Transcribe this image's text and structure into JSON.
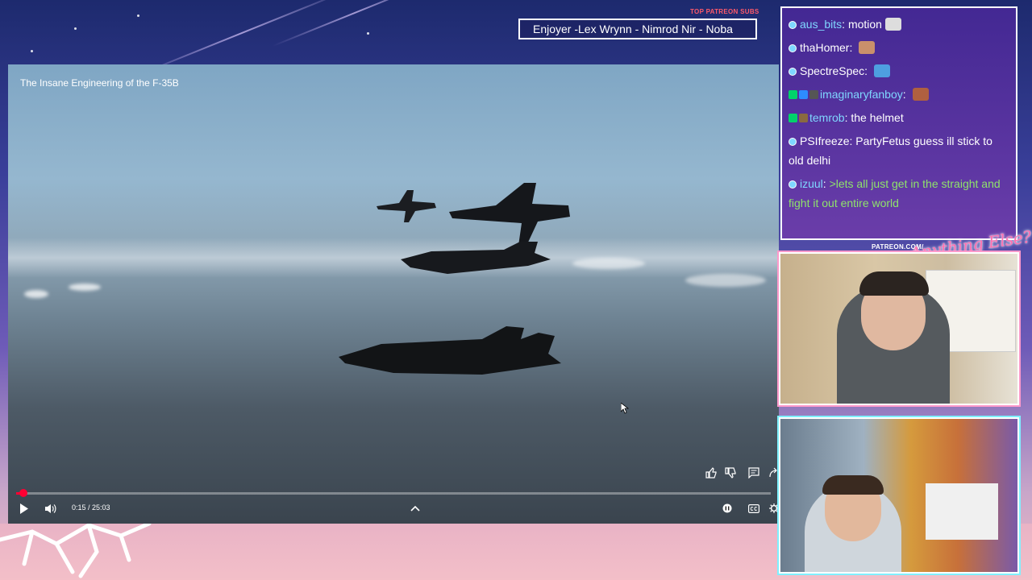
{
  "overlay": {
    "subs_label": "TOP PATREON SUBS",
    "subs_ticker": "Enjoyer -Lex Wrynn - Nimrod Nir - Noba",
    "patreon_tag": "PATREON.COM/",
    "logo_text": "Anything Else?"
  },
  "video": {
    "title": "The Insane Engineering of the F-35B",
    "time": "0:15 / 25:03",
    "progress_fraction": 0.01
  },
  "chat": {
    "messages": [
      {
        "user": "aus_bits",
        "text": "motion",
        "user_color": "#7fd7ff"
      },
      {
        "user": "thaHomer",
        "text": "",
        "user_color": "#ffffff"
      },
      {
        "user": "SpectreSpec",
        "text": "",
        "user_color": "#ffffff"
      },
      {
        "user": "imaginaryfanboy",
        "text": "",
        "user_color": "#7fd7ff"
      },
      {
        "user": "temrob",
        "text": "the helmet",
        "user_color": "#7fd7ff"
      },
      {
        "user": "PSIfreeze",
        "text": "PartyFetus guess ill stick to old delhi",
        "user_color": "#ffffff"
      },
      {
        "user": "izuul",
        "text": ">lets all just get in the straight and fight it out entire world",
        "user_color": "#7fd7ff",
        "text_color": "#8fe36a"
      }
    ]
  }
}
